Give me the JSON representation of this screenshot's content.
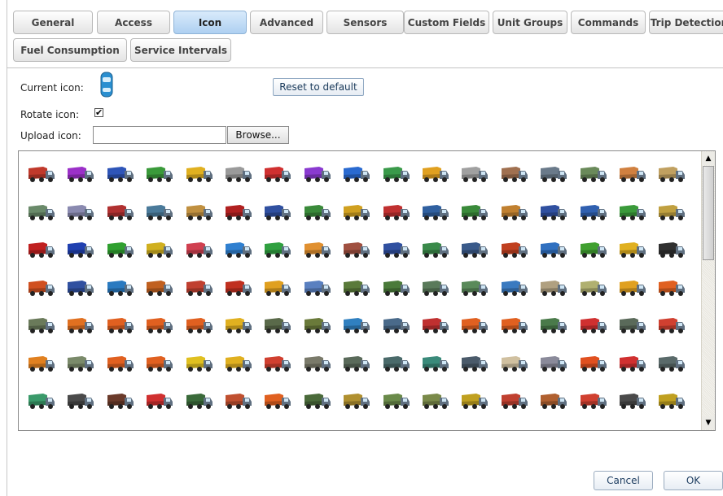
{
  "tabs": [
    {
      "label": "General",
      "active": false
    },
    {
      "label": "Access",
      "active": false
    },
    {
      "label": "Icon",
      "active": true
    },
    {
      "label": "Advanced",
      "active": false
    },
    {
      "label": "Sensors",
      "active": false
    },
    {
      "label": "Custom Fields",
      "active": false
    },
    {
      "label": "Unit Groups",
      "active": false
    },
    {
      "label": "Commands",
      "active": false
    },
    {
      "label": "Trip Detection",
      "active": false
    },
    {
      "label": "Fuel Consumption",
      "active": false
    },
    {
      "label": "Service Intervals",
      "active": false
    }
  ],
  "icon_panel": {
    "current_icon_label": "Current icon:",
    "current_icon": "car-icon",
    "reset_label": "Reset to default",
    "rotate_label": "Rotate icon:",
    "rotate_checked": true,
    "upload_label": "Upload icon:",
    "upload_value": "",
    "browse_label": "Browse..."
  },
  "icon_grid": {
    "rows": [
      [
        "truck-icon",
        "truck-icon",
        "truck-icon",
        "truck-icon",
        "truck-icon",
        "truck-icon",
        "truck-icon",
        "truck-icon",
        "truck-icon",
        "truck-icon",
        "truck-icon",
        "truck-icon",
        "truck-icon",
        "truck-icon",
        "truck-icon",
        "truck-icon",
        "truck-icon"
      ],
      [
        "truck-icon",
        "truck-icon",
        "truck-icon",
        "truck-icon",
        "truck-icon",
        "semi-truck-icon",
        "semi-truck-icon",
        "semi-truck-icon",
        "semi-truck-icon",
        "semi-truck-icon",
        "semi-truck-icon",
        "semi-truck-icon",
        "semi-truck-icon",
        "semi-truck-icon",
        "semi-truck-icon",
        "semi-truck-icon",
        "semi-truck-icon"
      ],
      [
        "truck-cab-icon",
        "truck-cab-icon",
        "truck-cab-icon",
        "truck-cab-icon",
        "truck-cab-icon",
        "truck-cab-icon",
        "truck-cab-icon",
        "truck-cab-icon",
        "dump-truck-icon",
        "dump-truck-icon",
        "dump-truck-icon",
        "dump-truck-icon",
        "flatbed-truck-icon",
        "flatbed-truck-icon",
        "flatbed-truck-icon",
        "flatbed-truck-icon",
        "flatbed-truck-icon"
      ],
      [
        "dump-truck-icon",
        "truck-icon",
        "truck-icon",
        "crane-truck-icon",
        "truck-icon",
        "truck-icon",
        "truck-icon",
        "truck-icon",
        "truck-icon",
        "truck-icon",
        "truck-icon",
        "truck-icon",
        "truck-icon",
        "truck-icon",
        "truck-icon",
        "truck-icon",
        "truck-icon"
      ],
      [
        "truck-icon",
        "dump-truck-icon",
        "dump-truck-icon",
        "dump-truck-icon",
        "dump-truck-icon",
        "dump-truck-icon",
        "truck-icon",
        "truck-icon",
        "truck-icon",
        "truck-icon",
        "truck-icon",
        "truck-icon",
        "dump-truck-icon",
        "dump-truck-icon",
        "truck-icon",
        "truck-icon",
        "truck-icon"
      ],
      [
        "dump-truck-icon",
        "tanker-truck-icon",
        "dump-truck-icon",
        "dump-truck-icon",
        "loader-icon",
        "dump-truck-icon",
        "truck-icon",
        "truck-icon",
        "truck-icon",
        "truck-icon",
        "truck-icon",
        "truck-icon",
        "truck-icon",
        "truck-icon",
        "truck-icon",
        "truck-icon",
        "truck-icon"
      ],
      [
        "tow-truck-icon",
        "truck-icon",
        "truck-icon",
        "fire-truck-icon",
        "truck-icon",
        "truck-icon",
        "truck-icon",
        "truck-icon",
        "truck-icon",
        "truck-icon",
        "truck-icon",
        "truck-icon",
        "truck-icon",
        "truck-icon",
        "truck-icon",
        "truck-icon",
        "truck-icon"
      ],
      [
        "truck-icon",
        "truck-icon",
        "truck-icon",
        "truck-icon",
        "truck-icon",
        "truck-icon",
        "truck-icon",
        "truck-icon",
        "truck-icon",
        "truck-icon",
        "truck-icon",
        "truck-icon",
        "truck-icon",
        "truck-icon",
        "truck-icon",
        "truck-icon",
        "truck-icon"
      ]
    ],
    "colors": [
      [
        "#c0392b",
        "#9b30c8",
        "#2e55b8",
        "#3a9a3a",
        "#e0b020",
        "#9a9a9a",
        "#d03030",
        "#8a3ad0",
        "#2a6ad0",
        "#3a9a4a",
        "#e0a020",
        "#a0a0a0",
        "#a07050",
        "#6a7a8a",
        "#6a8a5a",
        "#d08040",
        "#c0a060"
      ],
      [
        "#6a8a6a",
        "#8a8ab0",
        "#b03030",
        "#4a7a9a",
        "#c09040",
        "#b02020",
        "#3050a0",
        "#3a8a3a",
        "#d0a020",
        "#c03030",
        "#3060a0",
        "#3a8a3a",
        "#c08030",
        "#3050a0",
        "#3060b0",
        "#3a9a3a",
        "#c0a040"
      ],
      [
        "#c02020",
        "#2040b0",
        "#30a030",
        "#d0b020",
        "#d04050",
        "#3080d0",
        "#30a040",
        "#e09030",
        "#a05040",
        "#3050a0",
        "#3a8a4a",
        "#3a5a8a",
        "#c04020",
        "#3070c0",
        "#40a030",
        "#e0b020",
        "#303030"
      ],
      [
        "#d05020",
        "#3050a0",
        "#2a7ac0",
        "#c06020",
        "#c04030",
        "#c03020",
        "#e0a020",
        "#5a80c0",
        "#5a7a3a",
        "#4a7a3a",
        "#5a7a5a",
        "#5a8a5a",
        "#3a7ac0",
        "#b0a080",
        "#b0b070",
        "#e0a020",
        "#e06020"
      ],
      [
        "#6a7a5a",
        "#e07020",
        "#e06020",
        "#e06020",
        "#e06020",
        "#e0b020",
        "#5a6a4a",
        "#6a7a3a",
        "#3080c0",
        "#4a6a8a",
        "#c03030",
        "#e06020",
        "#e06020",
        "#4a7a4a",
        "#d03030",
        "#5a6a5a",
        "#d04030"
      ],
      [
        "#e08020",
        "#7a8a6a",
        "#e06020",
        "#e06020",
        "#e0c020",
        "#e0b020",
        "#d04030",
        "#7a7a6a",
        "#5a6a5a",
        "#4a6a6a",
        "#3a8a7a",
        "#4a5a6a",
        "#d0c0a0",
        "#8a8a9a",
        "#e05020",
        "#d03030",
        "#5a6a6a"
      ],
      [
        "#3a9a6a",
        "#4a4a4a",
        "#6a3a2a",
        "#d03030",
        "#3a6a3a",
        "#c05030",
        "#e06020",
        "#4a6a3a",
        "#b09030",
        "#6a8a4a",
        "#7a8a4a",
        "#c0a020",
        "#c04030",
        "#b06030",
        "#d04030",
        "#4a4a4a",
        "#c0a020"
      ],
      [
        "#3a8a9a",
        "#e0a020",
        "#e0c020",
        "#4a6a8a",
        "#b0b0c0",
        "#5a6a8a",
        "#c0c0c0",
        "#d08030",
        "#3040a0",
        "#8a8a8a",
        "#3a3a3a",
        "#8a8a8a",
        "#c05050",
        "#3060b0",
        "#c03030",
        "#e0a020",
        "#d08030"
      ]
    ]
  },
  "footer": {
    "cancel_label": "Cancel",
    "ok_label": "OK"
  }
}
